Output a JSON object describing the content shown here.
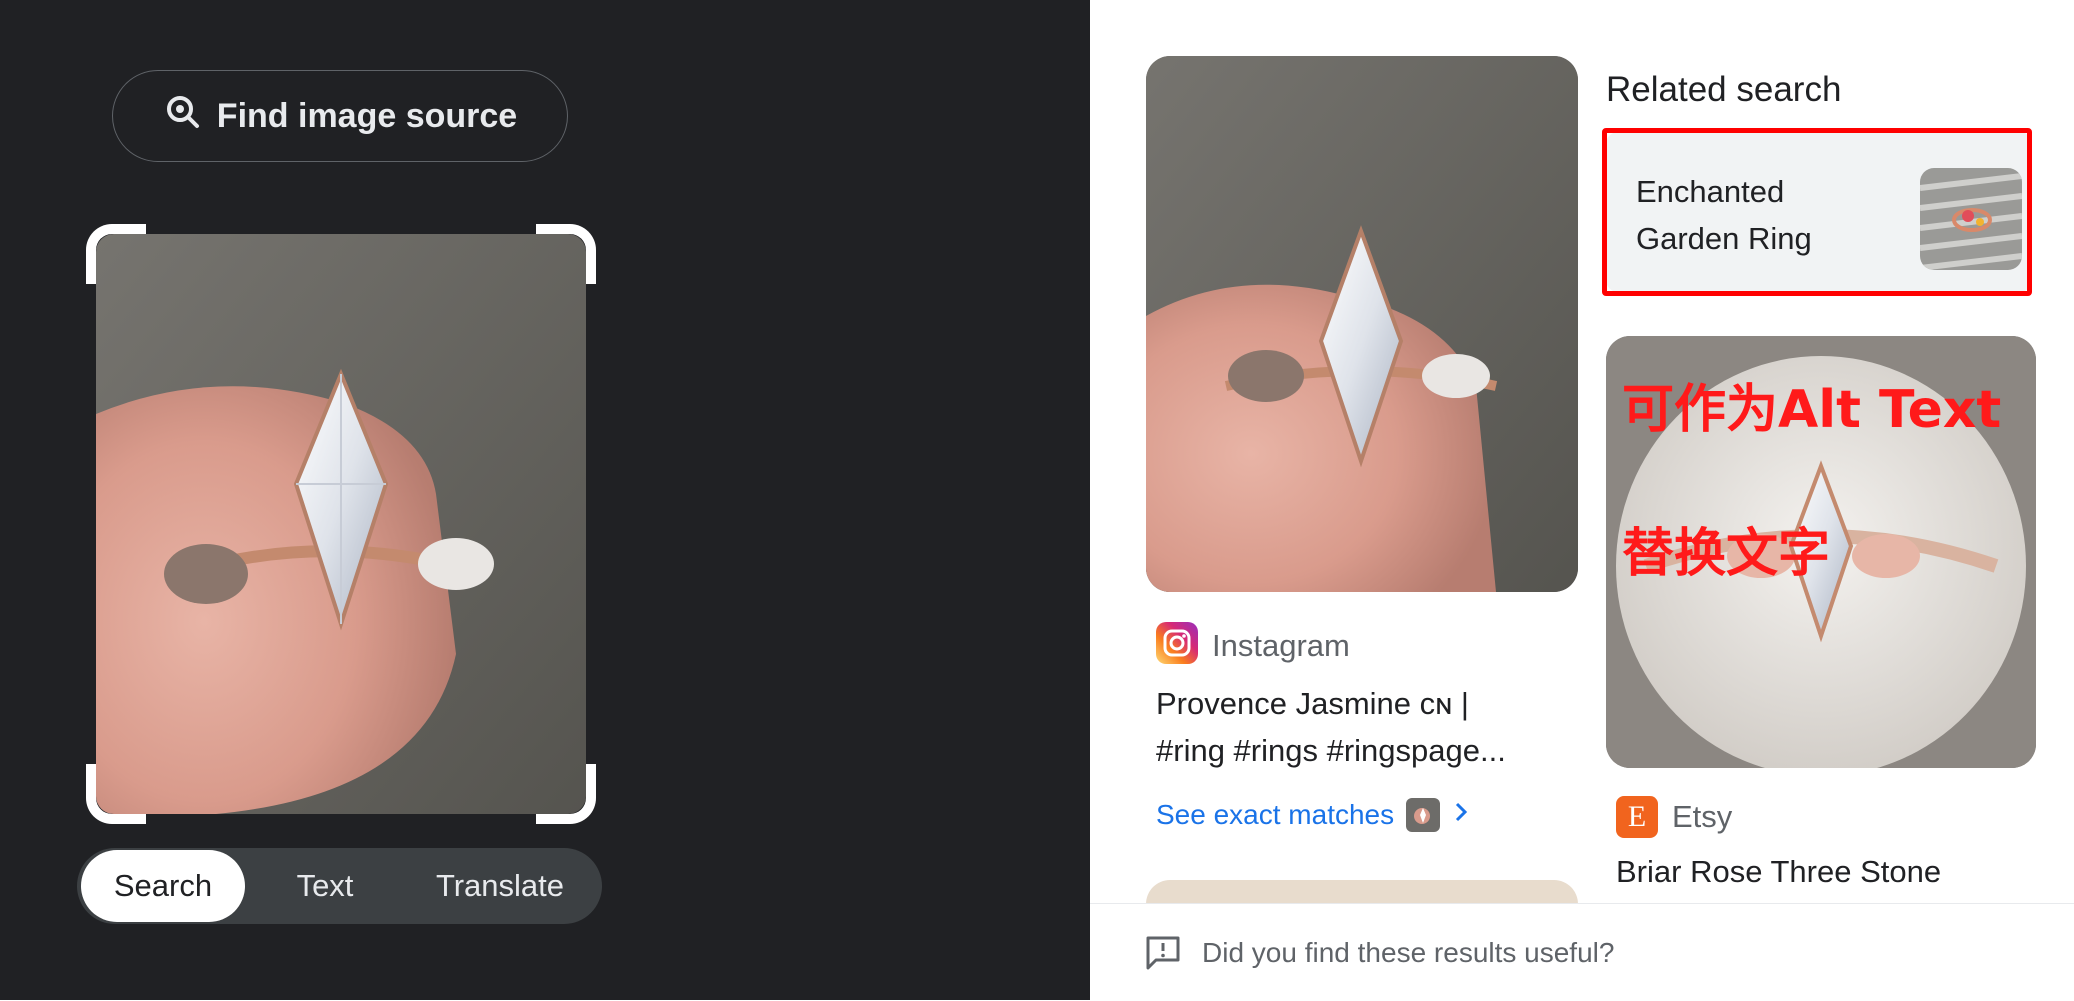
{
  "lens": {
    "find_source_label": "Find image source",
    "tabs": [
      {
        "label": "Search",
        "active": true
      },
      {
        "label": "Text",
        "active": false
      },
      {
        "label": "Translate",
        "active": false
      }
    ]
  },
  "results": {
    "first": {
      "source": "Instagram",
      "title_line1": "Provence Jasmine ᴄɴ |",
      "title_line2": "#ring #rings #ringspage...",
      "exact_matches_label": "See exact matches"
    },
    "second": {
      "source": "Etsy",
      "source_letter": "E",
      "title": "Briar Rose Three Stone"
    }
  },
  "related": {
    "heading": "Related search",
    "item_line1": "Enchanted",
    "item_line2": "Garden Ring"
  },
  "annotation": {
    "line1": "可作为Alt Text",
    "line2": "替换文字"
  },
  "feedback": {
    "question": "Did you find these results useful?"
  },
  "colors": {
    "dark_bg": "#202124",
    "link_blue": "#1a73e8",
    "annotation_red": "#ff0000",
    "etsy_orange": "#f1641e"
  }
}
